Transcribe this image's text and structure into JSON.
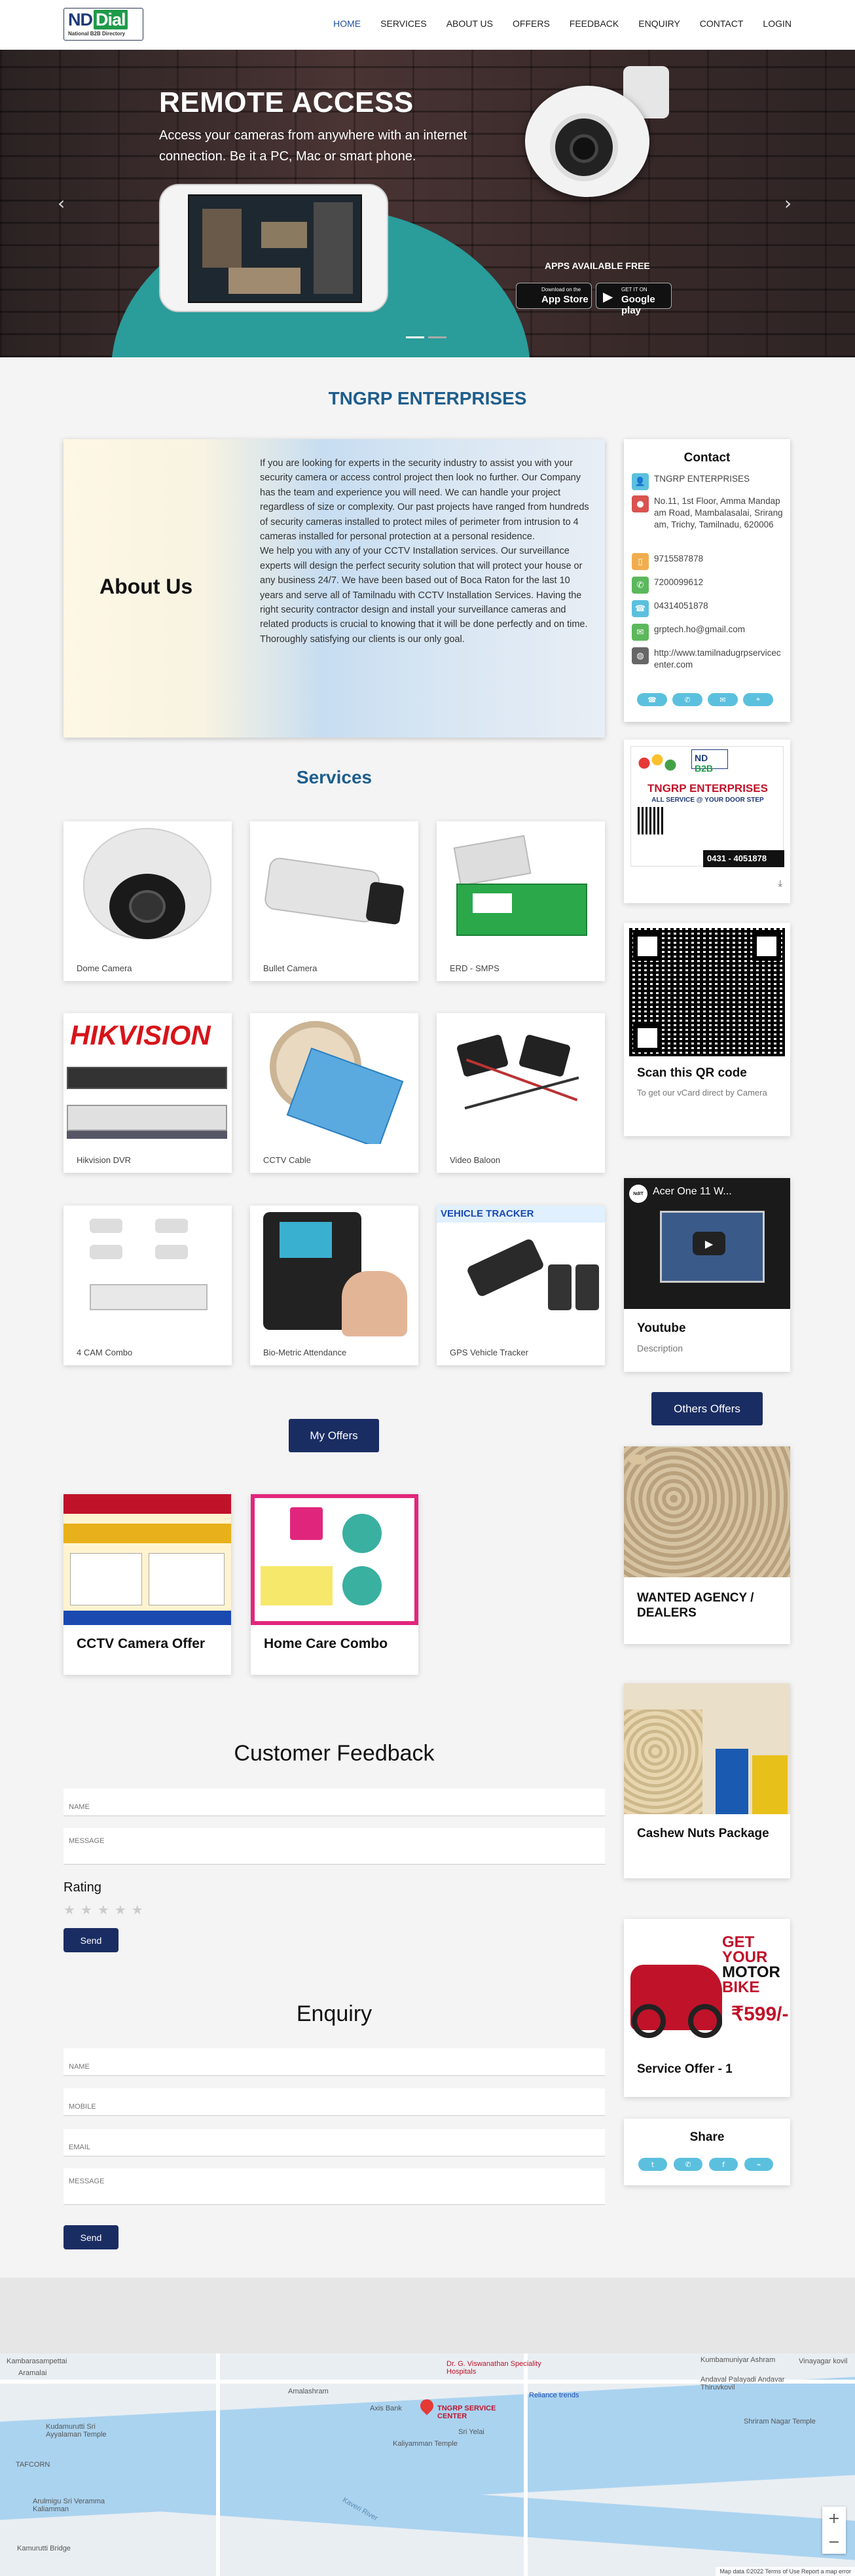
{
  "header": {
    "logo": {
      "nd": "ND",
      "dial": "Dial",
      "tagline": "National B2B Directory"
    },
    "nav": [
      "HOME",
      "SERVICES",
      "ABOUT US",
      "OFFERS",
      "FEEDBACK",
      "ENQUIRY",
      "CONTACT",
      "LOGIN"
    ],
    "active": "HOME"
  },
  "hero": {
    "title": "REMOTE ACCESS",
    "subtitle": "Access your cameras from anywhere with an internet connection.  Be it a PC, Mac or smart phone.",
    "apps_label": "APPS AVAILABLE FREE",
    "app_store": {
      "small": "Download on the",
      "big": "App Store"
    },
    "google_play": {
      "small": "GET IT ON",
      "big": "Google play"
    }
  },
  "company_name": "TNGRP ENTERPRISES",
  "about": {
    "heading": "About Us",
    "text": "If you are looking for experts in the security industry to assist you with your security camera or access control project then look no further. Our Company has the team and experience you will need. We can handle your project regardless of size or complexity. Our past projects have ranged from hundreds of security cameras installed to protect miles of perimeter from intrusion to 4 cameras installed for personal protection at a personal residence.\nWe help you with any of your CCTV Installation services. Our surveillance experts will design the perfect security solution that will protect your house or any business 24/7. We have been based out of Boca Raton for the last 10 years and serve all of Tamilnadu with CCTV Installation Services. Having the right security contractor design and install your surveillance cameras and related products is crucial to knowing that it will be done perfectly and on time. Thoroughly satisfying our clients is our only goal."
  },
  "contact": {
    "heading": "Contact",
    "items": [
      {
        "icon": "user-icon",
        "color": "#5bc0de",
        "text": "TNGRP ENTERPRISES"
      },
      {
        "icon": "location-pin-icon",
        "color": "#d9534f",
        "text": "No.11, 1st Floor, Amma Mandapam Road, Mambalasalai, Srirangam, Trichy, Tamilnadu, 620006"
      },
      {
        "icon": "mobile-icon",
        "color": "#f0ad4e",
        "text": "9715587878"
      },
      {
        "icon": "whatsapp-icon",
        "color": "#5cb85c",
        "text": "7200099612"
      },
      {
        "icon": "phone-icon",
        "color": "#5bc0de",
        "text": "04314051878"
      },
      {
        "icon": "email-icon",
        "color": "#5cb85c",
        "text": "grptech.ho@gmail.com"
      },
      {
        "icon": "globe-icon",
        "color": "#666666",
        "text": "http://www.tamilnadugrpservicecenter.com"
      }
    ],
    "buttons": [
      "phone-icon",
      "whatsapp-icon",
      "email-icon",
      "location-icon"
    ]
  },
  "services": {
    "heading": "Services",
    "items": [
      "Dome Camera",
      "Bullet Camera",
      "ERD - SMPS",
      "Hikvision DVR",
      "CCTV Cable",
      "Video Baloon",
      "4 CAM Combo",
      "Bio-Metric Attendance",
      "GPS Vehicle Tracker"
    ]
  },
  "my_offers": {
    "button": "My Offers",
    "items": [
      "CCTV Camera Offer",
      "Home Care Combo"
    ]
  },
  "sidebar": {
    "visiting_card": {
      "company": "TNGRP ENTERPRISES",
      "tagline": "ALL SERVICE @ YOUR DOOR STEP",
      "phone": "0431 - 4051878"
    },
    "qr": {
      "title": "Scan this QR code",
      "text": "To get our vCard direct by Camera"
    },
    "youtube": {
      "title": "Youtube",
      "text": "Description",
      "video_title": "Acer One 11 W..."
    },
    "others_button": "Others Offers",
    "offers": [
      "WANTED AGENCY / DEALERS",
      "Cashew Nuts Package",
      "Service Offer - 1"
    ],
    "bike_offer": {
      "line1": "GET YOUR",
      "line2": "MOTOR",
      "line3": "BIKE",
      "price": "₹599/-"
    }
  },
  "feedback": {
    "heading": "Customer Feedback",
    "name_placeholder": "NAME",
    "message_placeholder": "MESSAGE",
    "rating_label": "Rating",
    "stars": 5,
    "send": "Send"
  },
  "enquiry": {
    "heading": "Enquiry",
    "name_placeholder": "NAME",
    "mobile_placeholder": "MOBILE",
    "email_placeholder": "EMAIL",
    "message_placeholder": "MESSAGE",
    "send": "Send"
  },
  "share": {
    "heading": "Share",
    "buttons": [
      "twitter-icon",
      "whatsapp-icon",
      "facebook-icon",
      "link-icon"
    ]
  },
  "map": {
    "labels": [
      "Kambarasampettai",
      "Aramalai",
      "Amalashram",
      "Axis Bank",
      "Dr. G. Viswanathan Speciality Hospitals",
      "TNGRP SERVICE CENTER",
      "Reliance trends",
      "Kumbamuniyar Ashram",
      "Andaval Palayadi Andavar Thiruvkovil",
      "Vinayagar kovil",
      "Shriram Nagar Temple",
      "Kudamurutti Sri Ayyalaman Temple",
      "TAFCORN",
      "Arulmigu Sri Veramma Kaliamman",
      "Kamurutti Bridge",
      "Kaliyamman Temple",
      "Sri Yelai",
      "Kaveri River"
    ],
    "footer": "Map data ©2022  Terms of Use  Report a map error"
  }
}
